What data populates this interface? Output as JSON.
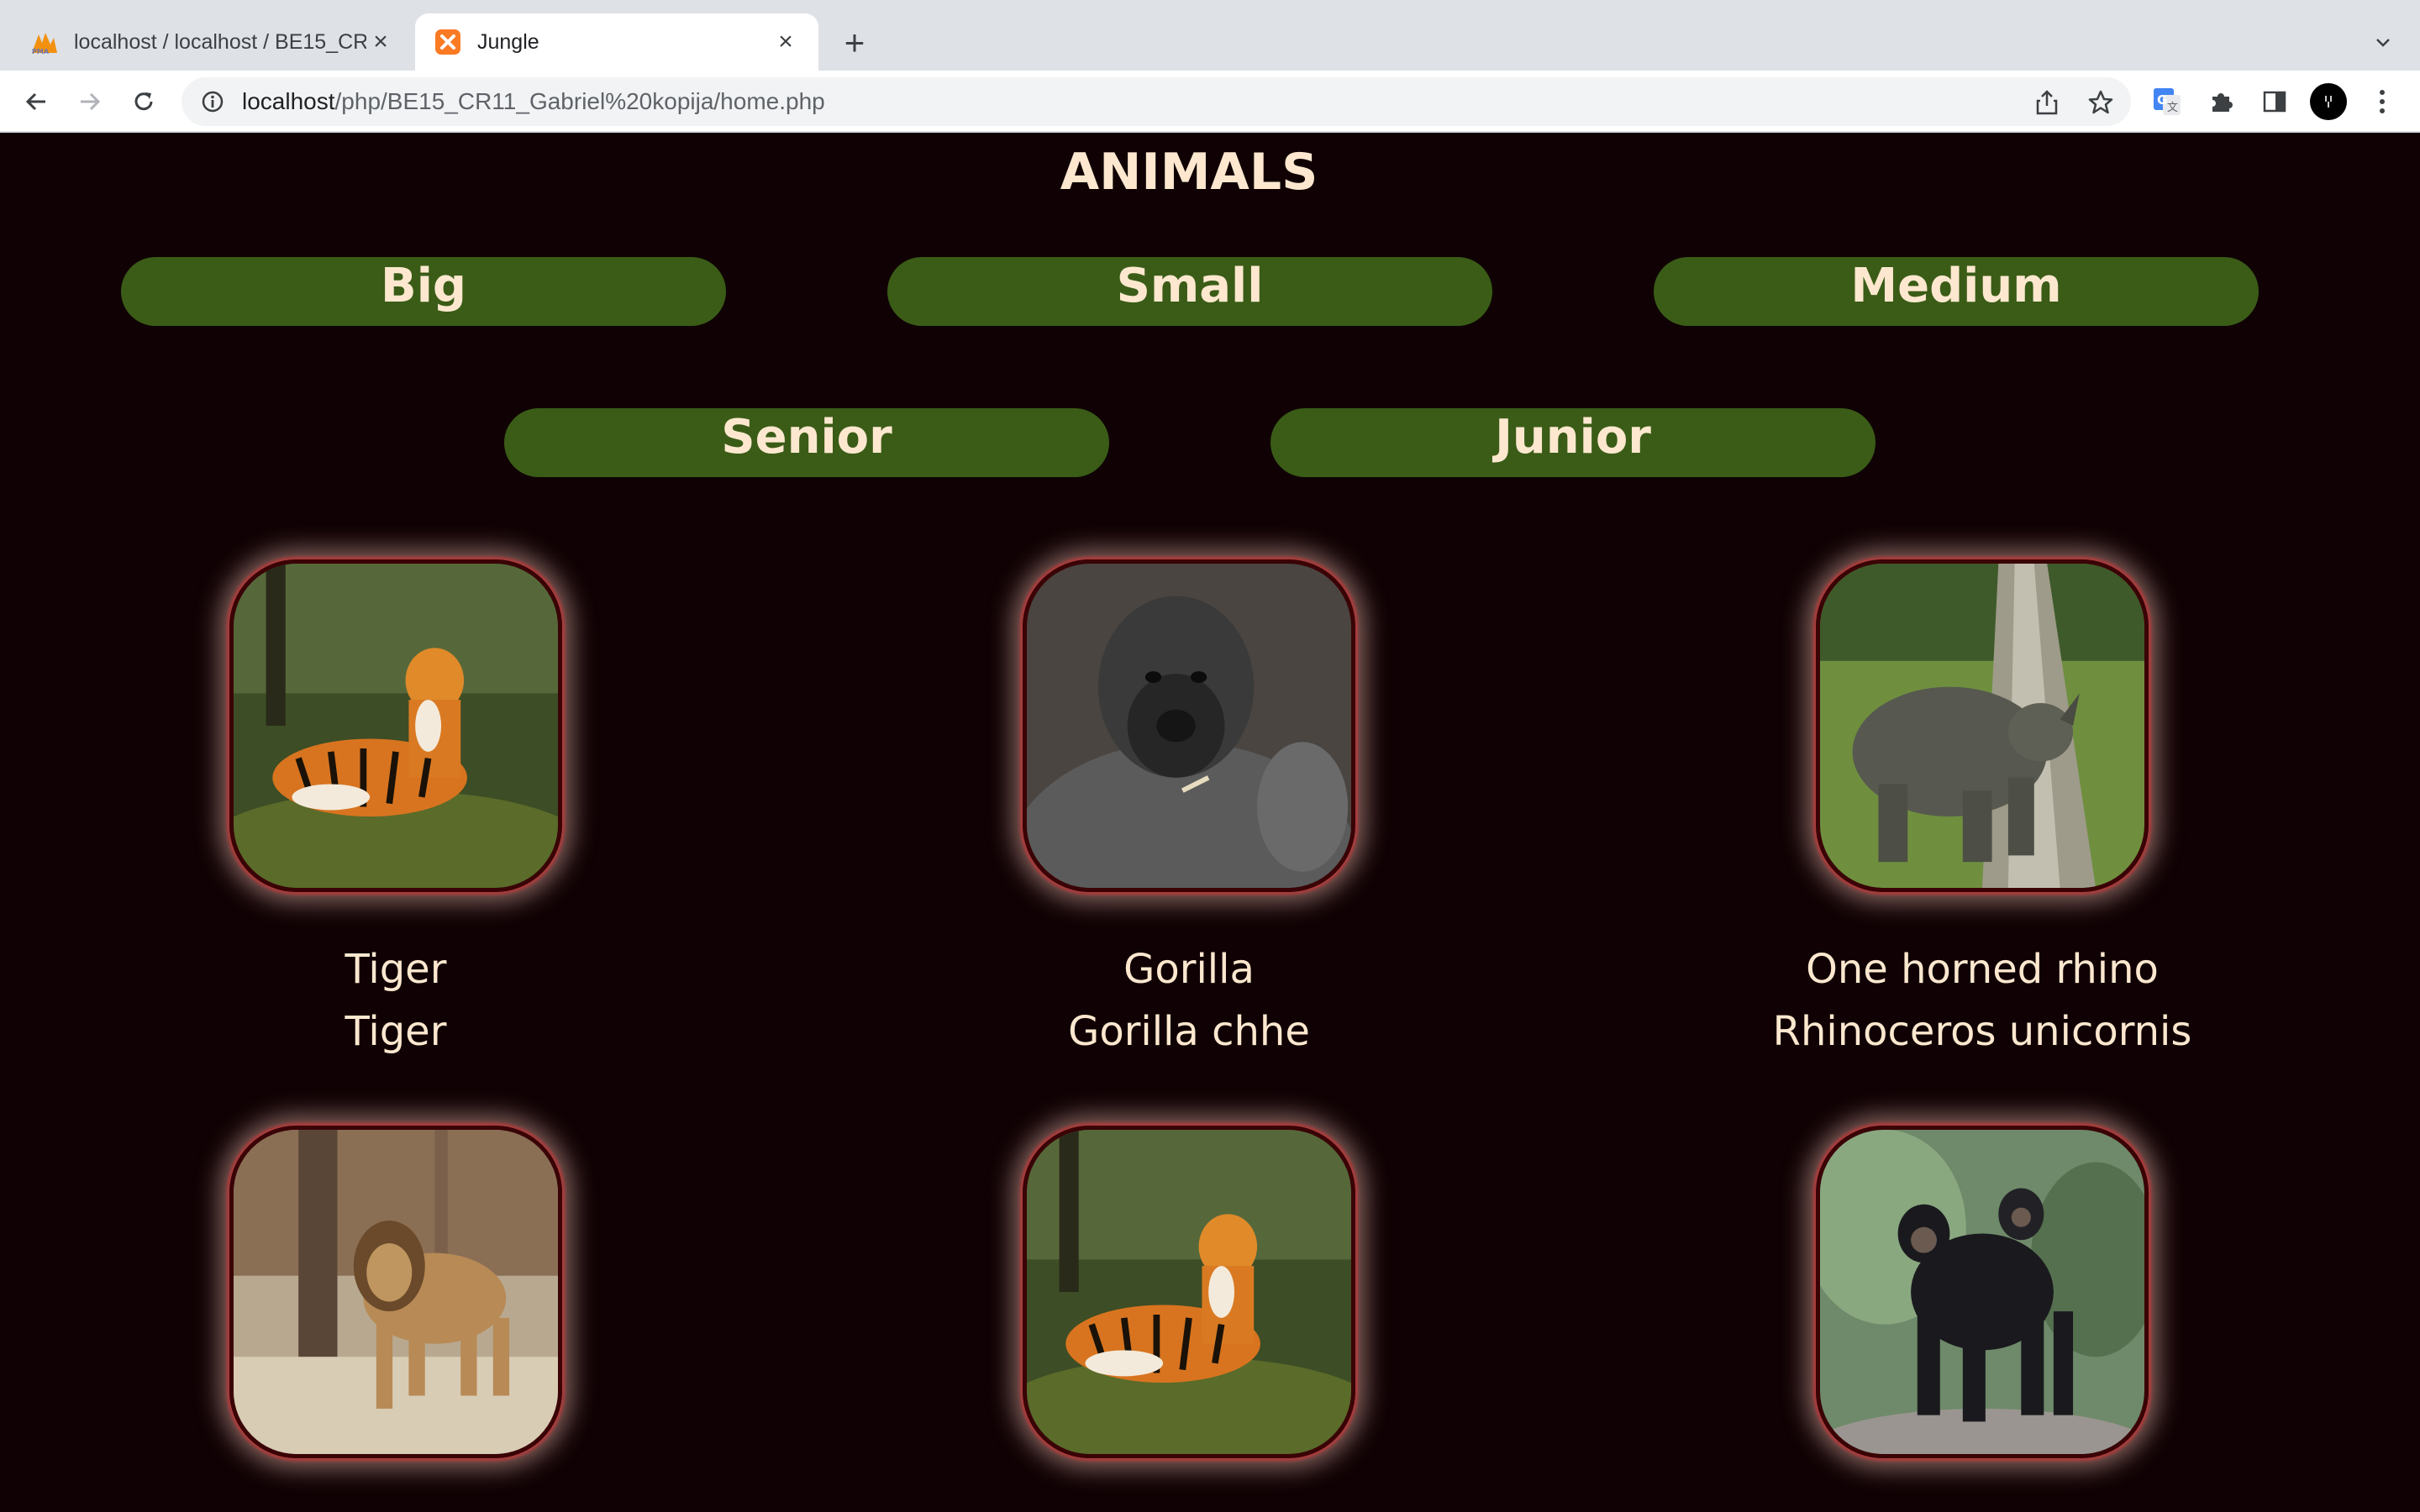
{
  "browser": {
    "tabs": [
      {
        "title": "localhost / localhost / BE15_CR",
        "favicon": "phpmyadmin-icon",
        "active": false
      },
      {
        "title": "Jungle",
        "favicon": "xampp-icon",
        "active": true
      }
    ],
    "url": {
      "host": "localhost",
      "path": "/php/BE15_CR11_Gabriel%20kopija/home.php"
    }
  },
  "page": {
    "title": "ANIMALS",
    "filters": [
      "Big",
      "Small",
      "Medium",
      "Senior",
      "Junior"
    ]
  },
  "animals": [
    {
      "name": "Tiger",
      "scientific": "Tiger",
      "image": "tiger"
    },
    {
      "name": "Gorilla",
      "scientific": "Gorilla chhe",
      "image": "gorilla"
    },
    {
      "name": "One horned rhino",
      "scientific": "Rhinoceros unicornis",
      "image": "rhino"
    },
    {
      "name": "",
      "scientific": "",
      "image": "lion"
    },
    {
      "name": "",
      "scientific": "",
      "image": "tiger"
    },
    {
      "name": "",
      "scientific": "",
      "image": "chimpanzee"
    }
  ],
  "colors": {
    "page_bg": "#100204",
    "button_bg": "#3a5c17",
    "text": "#fde8cf",
    "frame_glow": "#b53a3a"
  }
}
